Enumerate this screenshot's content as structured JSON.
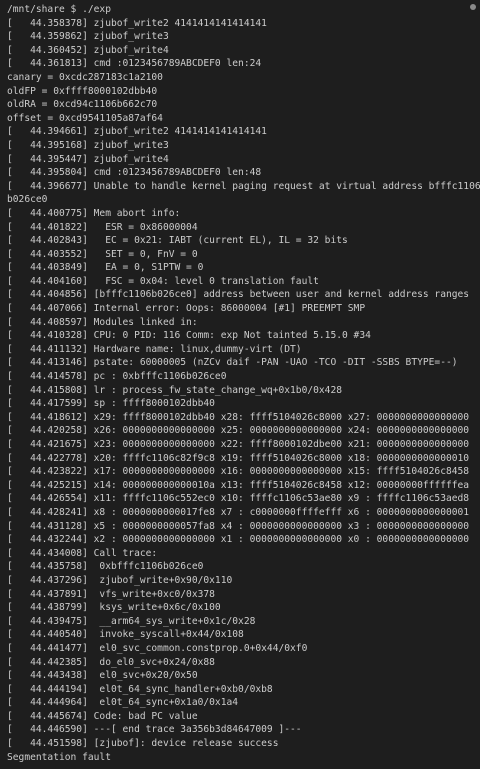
{
  "terminal": {
    "lines": [
      "/mnt/share $ ./exp",
      "[   44.358378] zjubof_write2 4141414141414141",
      "[   44.359862] zjubof_write3",
      "[   44.360452] zjubof_write4",
      "[   44.361813] cmd :0123456789ABCDEF0 len:24",
      "canary = 0xcdc287183c1a2100",
      "oldFP = 0xffff8000102dbb40",
      "oldRA = 0xcd94c1106b662c70",
      "offset = 0xcd9541105a87af64",
      "[   44.394661] zjubof_write2 4141414141414141",
      "[   44.395168] zjubof_write3",
      "[   44.395447] zjubof_write4",
      "[   44.395804] cmd :0123456789ABCDEF0 len:48",
      "[   44.396677] Unable to handle kernel paging request at virtual address bfffc1106",
      "b026ce0",
      "[   44.400775] Mem abort info:",
      "[   44.401822]   ESR = 0x86000004",
      "[   44.402843]   EC = 0x21: IABT (current EL), IL = 32 bits",
      "[   44.403552]   SET = 0, FnV = 0",
      "[   44.403849]   EA = 0, S1PTW = 0",
      "[   44.404160]   FSC = 0x04: level 0 translation fault",
      "[   44.404856] [bfffc1106b026ce0] address between user and kernel address ranges",
      "[   44.407066] Internal error: Oops: 86000004 [#1] PREEMPT SMP",
      "[   44.408597] Modules linked in:",
      "[   44.410328] CPU: 0 PID: 116 Comm: exp Not tainted 5.15.0 #34",
      "[   44.411132] Hardware name: linux,dummy-virt (DT)",
      "[   44.413146] pstate: 60000005 (nZCv daif -PAN -UAO -TCO -DIT -SSBS BTYPE=--)",
      "[   44.414578] pc : 0xbfffc1106b026ce0",
      "[   44.415808] lr : process_fw_state_change_wq+0x1b0/0x428",
      "[   44.417599] sp : ffff8000102dbb40",
      "[   44.418612] x29: ffff8000102dbb40 x28: ffff5104026c8000 x27: 0000000000000000",
      "[   44.420258] x26: 0000000000000000 x25: 0000000000000000 x24: 0000000000000000",
      "[   44.421675] x23: 0000000000000000 x22: ffff8000102dbe00 x21: 0000000000000000",
      "[   44.422778] x20: ffffc1106c82f9c8 x19: ffff5104026c8000 x18: 0000000000000010",
      "[   44.423822] x17: 0000000000000000 x16: 0000000000000000 x15: ffff5104026c8458",
      "[   44.425215] x14: 000000000000010a x13: ffff5104026c8458 x12: 00000000ffffffea",
      "[   44.426554] x11: ffffc1106c552ec0 x10: ffffc1106c53ae80 x9 : ffffc1106c53aed8",
      "[   44.428241] x8 : 0000000000017fe8 x7 : c0000000ffffefff x6 : 0000000000000001",
      "[   44.431128] x5 : 0000000000057fa8 x4 : 0000000000000000 x3 : 0000000000000000",
      "[   44.432244] x2 : 0000000000000000 x1 : 0000000000000000 x0 : 0000000000000000",
      "[   44.434008] Call trace:",
      "[   44.435758]  0xbfffc1106b026ce0",
      "[   44.437296]  zjubof_write+0x90/0x110",
      "[   44.437891]  vfs_write+0xc0/0x378",
      "[   44.438799]  ksys_write+0x6c/0x100",
      "[   44.439475]  __arm64_sys_write+0x1c/0x28",
      "[   44.440540]  invoke_syscall+0x44/0x108",
      "[   44.441477]  el0_svc_common.constprop.0+0x44/0xf0",
      "[   44.442385]  do_el0_svc+0x24/0x88",
      "[   44.443438]  el0_svc+0x20/0x50",
      "[   44.444194]  el0t_64_sync_handler+0xb0/0xb8",
      "[   44.444964]  el0t_64_sync+0x1a0/0x1a4",
      "[   44.445674] Code: bad PC value",
      "[   44.446590] ---[ end trace 3a356b3d84647009 ]---",
      "[   44.451598] [zjubof]: device release success",
      "Segmentation fault"
    ]
  }
}
